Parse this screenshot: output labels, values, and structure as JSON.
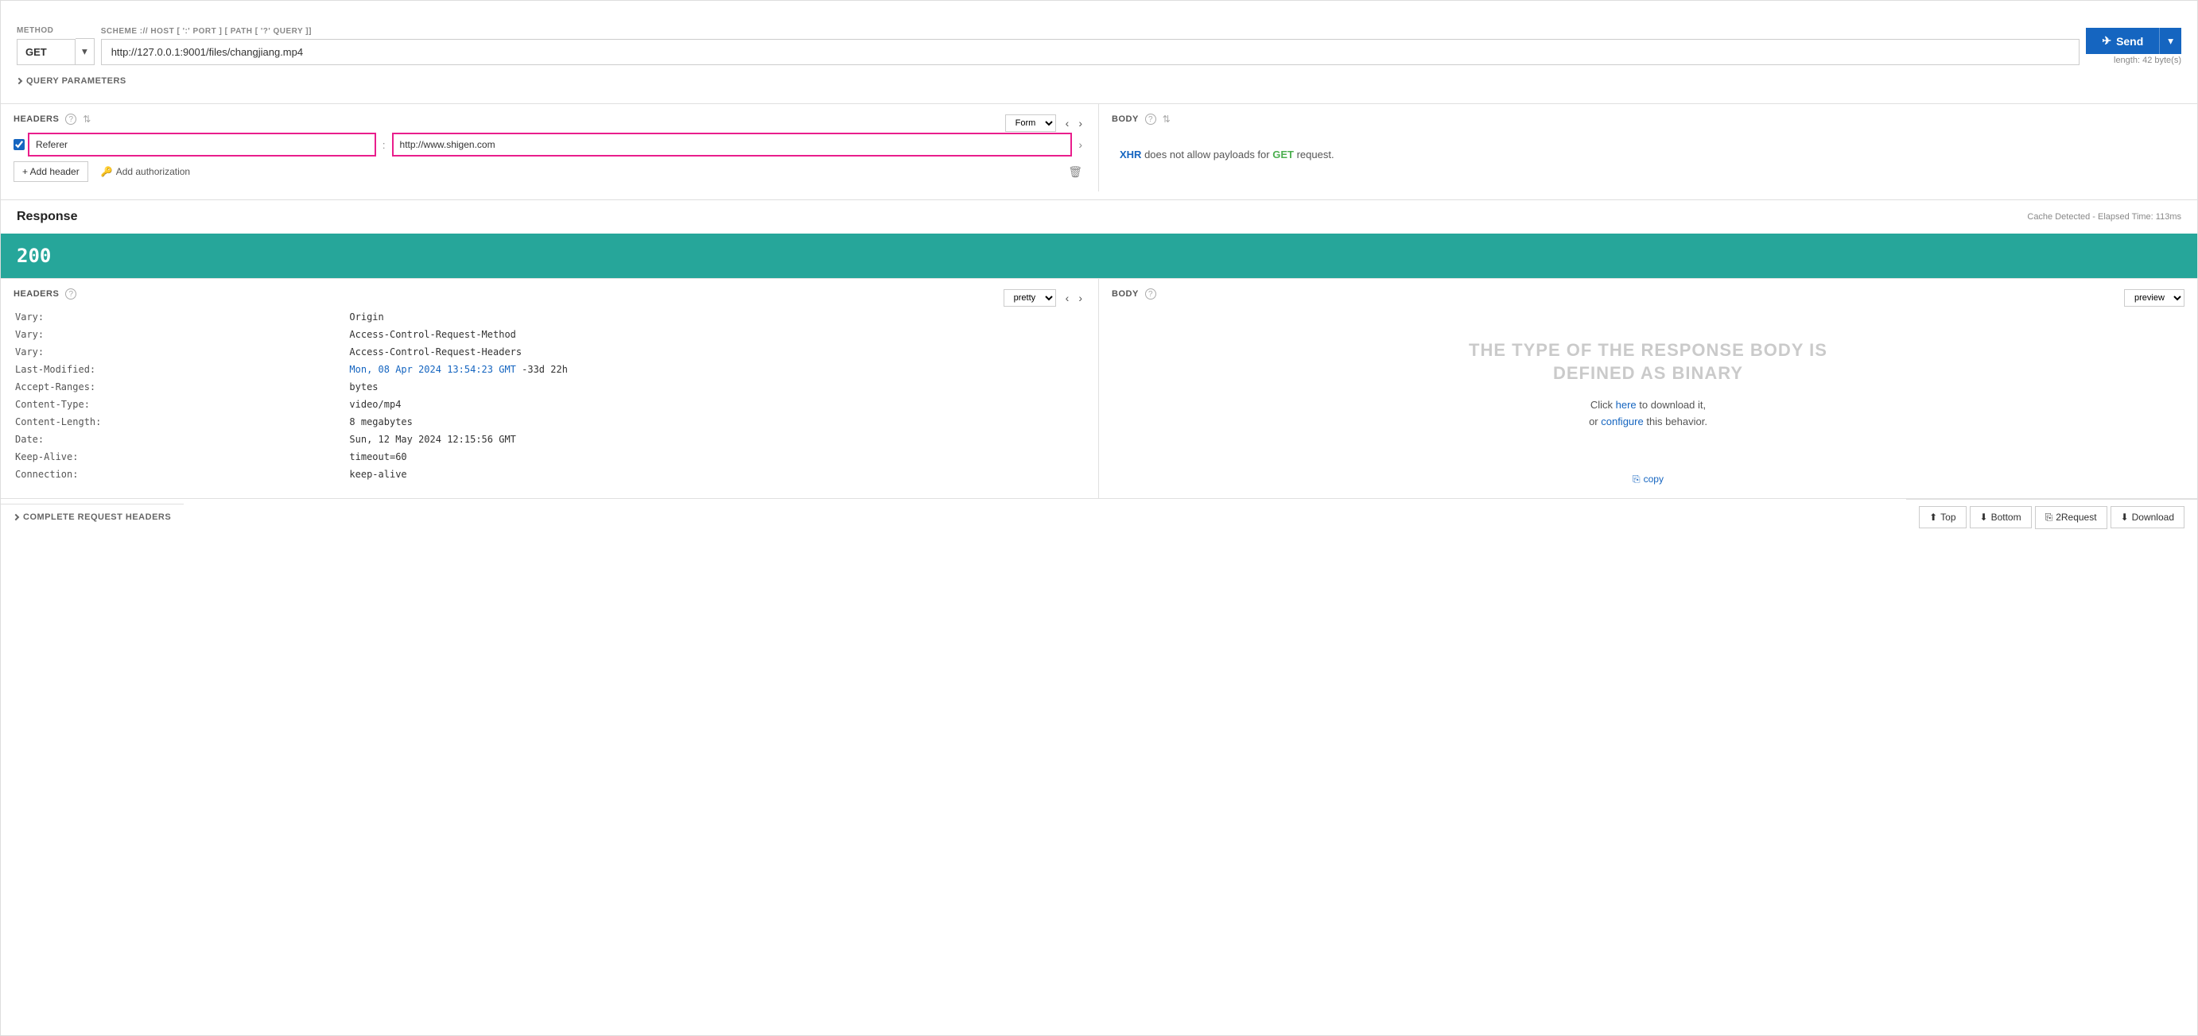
{
  "method": {
    "label": "METHOD",
    "value": "GET",
    "dropdown_label": "▾"
  },
  "url": {
    "label": "SCHEME :// HOST [ ':' PORT ] [ PATH [ '?' QUERY ]]",
    "value": "http://127.0.0.1:9001/files/changjiang.mp4",
    "length_info": "length: 42 byte(s)"
  },
  "send_button": {
    "label": "Send",
    "dropdown_arrow": "▾"
  },
  "query_params": {
    "label": "QUERY PARAMETERS"
  },
  "headers": {
    "label": "HEADERS",
    "form_label": "Form",
    "header_key": "Referer",
    "header_value": "http://www.shigen.com",
    "add_header_label": "+ Add header",
    "add_auth_label": "Add authorization"
  },
  "body_request": {
    "label": "BODY",
    "xhr_notice": "XHR does not allow payloads for GET request.",
    "xhr_text": "XHR",
    "get_text": "GET"
  },
  "response": {
    "title": "Response",
    "cache_info": "Cache Detected - Elapsed Time: 113ms",
    "status_code": "200",
    "headers_label": "HEADERS",
    "body_label": "BODY",
    "pretty_label": "pretty",
    "preview_label": "preview",
    "headers_data": [
      {
        "key": "Vary:",
        "value": "Origin"
      },
      {
        "key": "Vary:",
        "value": "Access-Control-Request-Method"
      },
      {
        "key": "Vary:",
        "value": "Access-Control-Request-Headers"
      },
      {
        "key": "Last-Modified:",
        "value": "Mon, 08 Apr 2024 13:54:23 GMT -33d 22h",
        "link": "Mon, 08 Apr 2024 13:54:23 GMT",
        "link_suffix": " -33d 22h"
      },
      {
        "key": "Accept-Ranges:",
        "value": "bytes"
      },
      {
        "key": "Content-Type:",
        "value": "video/mp4"
      },
      {
        "key": "Content-Length:",
        "value": "8 megabytes"
      },
      {
        "key": "Date:",
        "value": "Sun, 12 May 2024 12:15:56 GMT"
      },
      {
        "key": "Keep-Alive:",
        "value": "timeout=60"
      },
      {
        "key": "Connection:",
        "value": "keep-alive"
      }
    ],
    "binary_title": "THE TYPE OF THE RESPONSE BODY IS\nDEFINED AS BINARY",
    "binary_line1": "Click here to download it,",
    "binary_line2": "or configure this behavior.",
    "binary_here_link": "here",
    "binary_configure_link": "configure",
    "copy_label": "copy",
    "complete_request_label": "COMPLETE REQUEST HEADERS"
  },
  "footer": {
    "top_label": "Top",
    "bottom_label": "Bottom",
    "request_label": "2Request",
    "download_label": "Download"
  }
}
